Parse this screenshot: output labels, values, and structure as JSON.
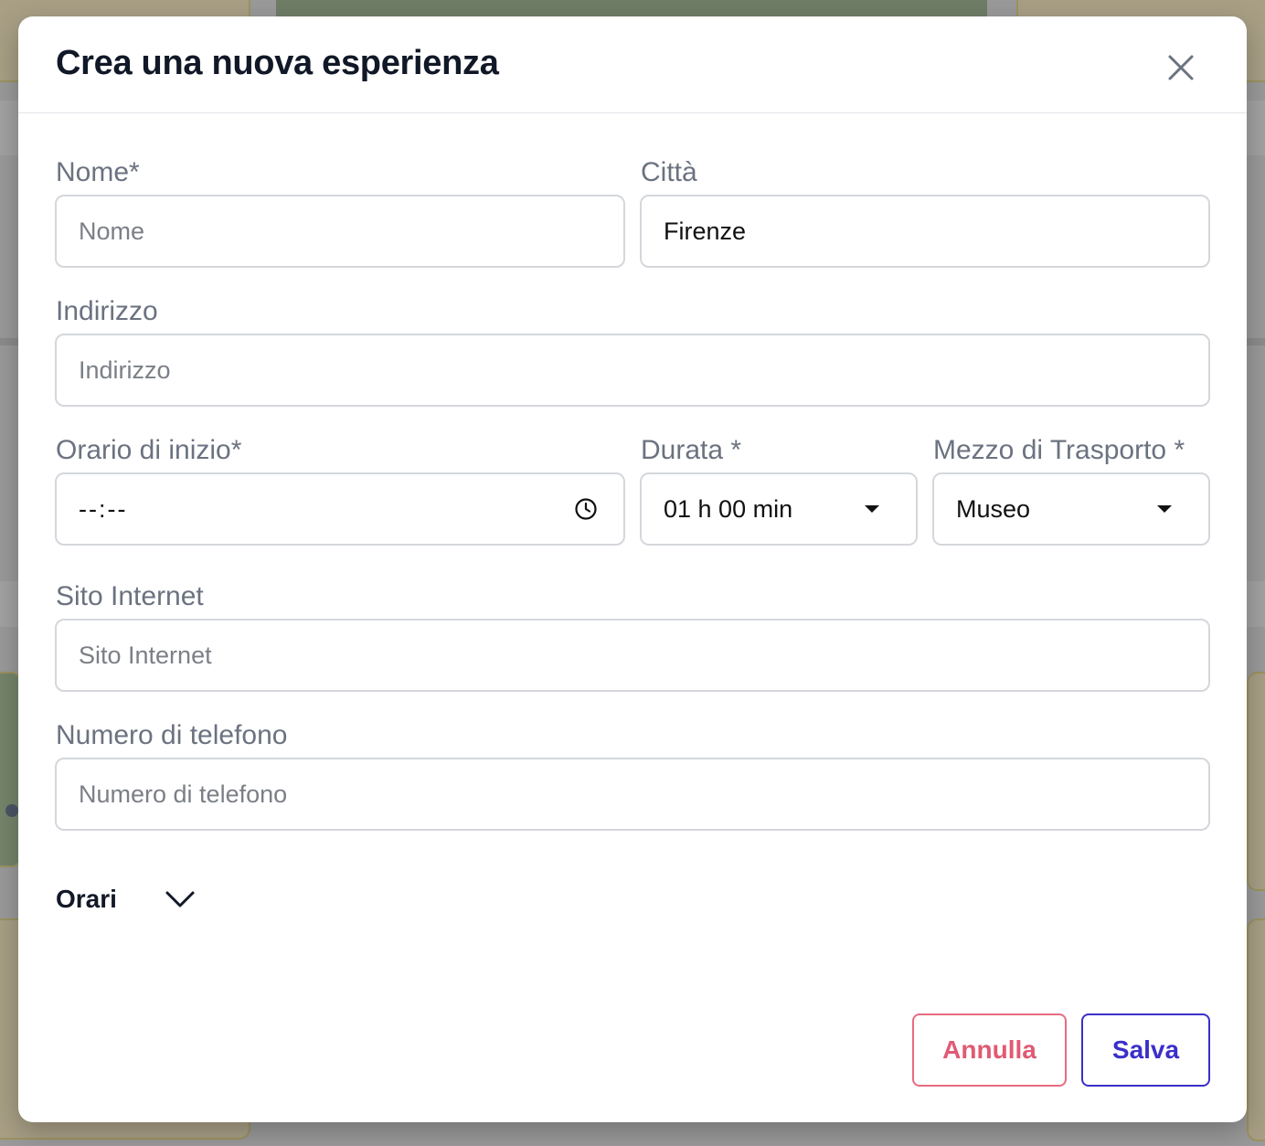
{
  "modal": {
    "title": "Crea una nuova esperienza"
  },
  "form": {
    "nome": {
      "label": "Nome*",
      "placeholder": "Nome",
      "value": ""
    },
    "citta": {
      "label": "Città",
      "placeholder": "",
      "value": "Firenze"
    },
    "indirizzo": {
      "label": "Indirizzo",
      "placeholder": "Indirizzo",
      "value": ""
    },
    "orario_inizio": {
      "label": "Orario di inizio*",
      "value": "--:--"
    },
    "durata": {
      "label": "Durata *",
      "value": "01 h 00 min"
    },
    "mezzo_trasporto": {
      "label": "Mezzo di Trasporto *",
      "value": "Museo"
    },
    "sito_internet": {
      "label": "Sito Internet",
      "placeholder": "Sito Internet",
      "value": ""
    },
    "telefono": {
      "label": "Numero di telefono",
      "placeholder": "Numero di telefono",
      "value": ""
    }
  },
  "orari": {
    "label": "Orari"
  },
  "actions": {
    "cancel_label": "Annulla",
    "save_label": "Salva"
  },
  "colors": {
    "cancel": "#e05a73",
    "save": "#3b2fc9",
    "title": "#111827",
    "label": "#6b7280",
    "border": "#d4d7dc"
  },
  "icons": {
    "close": "close-icon",
    "clock": "clock-icon",
    "chevron": "chevron-down-icon",
    "caret": "caret-down-icon"
  }
}
